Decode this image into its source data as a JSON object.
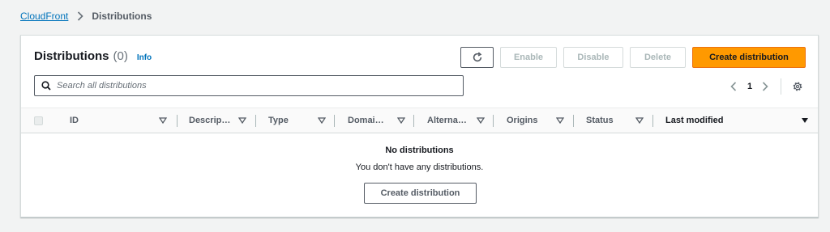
{
  "breadcrumb": {
    "root": "CloudFront",
    "current": "Distributions"
  },
  "header": {
    "title": "Distributions",
    "count": "(0)",
    "info": "Info"
  },
  "actions": {
    "refresh_icon": "refresh-icon",
    "enable": "Enable",
    "disable": "Disable",
    "delete": "Delete",
    "create": "Create distribution"
  },
  "search": {
    "placeholder": "Search all distributions",
    "value": ""
  },
  "pagination": {
    "page": "1"
  },
  "table": {
    "columns": [
      {
        "label": "ID"
      },
      {
        "label": "Descrip…"
      },
      {
        "label": "Type"
      },
      {
        "label": "Domai…"
      },
      {
        "label": "Alterna…"
      },
      {
        "label": "Origins"
      },
      {
        "label": "Status"
      },
      {
        "label": "Last modified"
      }
    ],
    "sorted_column": "Last modified"
  },
  "empty_state": {
    "title": "No distributions",
    "description": "You don't have any distributions.",
    "button": "Create distribution"
  },
  "colors": {
    "primary": "#ff9900",
    "link": "#0073bb",
    "background": "#f2f3f3"
  }
}
